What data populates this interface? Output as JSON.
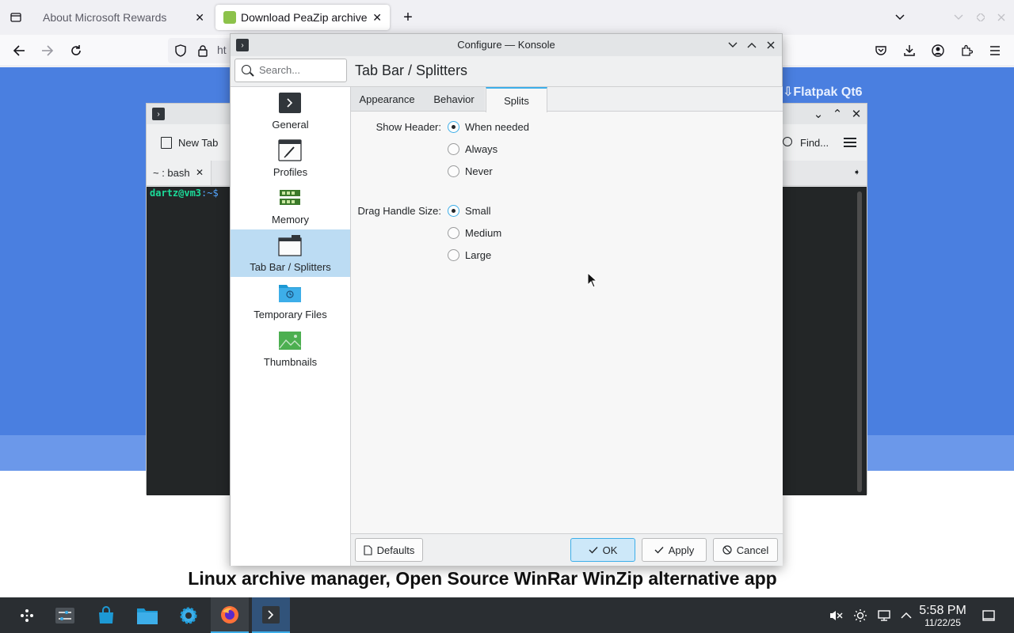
{
  "browser": {
    "tabs": [
      {
        "title": "About Microsoft Rewards",
        "close": "✕"
      },
      {
        "title": "Download PeaZip archive u",
        "close": "✕"
      }
    ],
    "new_tab": "+",
    "url_partial": "ht"
  },
  "webpage": {
    "flatpak_label": "⇩Flatpak Qt6",
    "headline": "Linux archive manager, Open Source WinRar WinZip alternative app"
  },
  "konsole": {
    "new_tab": "New Tab",
    "tab_label": "~ : bash",
    "find": "Find...",
    "prompt_user": "dartz@vm3",
    "prompt_path": ":~$"
  },
  "dialog": {
    "title": "Configure — Konsole",
    "search_placeholder": "Search...",
    "page_title": "Tab Bar / Splitters",
    "sidebar": [
      {
        "label": "General",
        "icon": "terminal-icon"
      },
      {
        "label": "Profiles",
        "icon": "profiles-icon"
      },
      {
        "label": "Memory",
        "icon": "memory-icon"
      },
      {
        "label": "Tab Bar / Splitters",
        "icon": "tabbar-icon",
        "selected": true
      },
      {
        "label": "Temporary Files",
        "icon": "folder-icon"
      },
      {
        "label": "Thumbnails",
        "icon": "image-icon"
      }
    ],
    "tabs": [
      {
        "label": "Appearance"
      },
      {
        "label": "Behavior"
      },
      {
        "label": "Splits",
        "active": true
      }
    ],
    "show_header": {
      "label": "Show Header:",
      "options": [
        "When needed",
        "Always",
        "Never"
      ],
      "selected": "When needed"
    },
    "drag_handle": {
      "label": "Drag Handle Size:",
      "options": [
        "Small",
        "Medium",
        "Large"
      ],
      "selected": "Small"
    },
    "buttons": {
      "defaults": "Defaults",
      "ok": "OK",
      "apply": "Apply",
      "cancel": "Cancel"
    }
  },
  "taskbar": {
    "time": "5:58 PM",
    "date": "11/22/25"
  },
  "colors": {
    "accent": "#3daee9",
    "selection": "#bcdcf3",
    "taskbar": "#2a2e32"
  }
}
